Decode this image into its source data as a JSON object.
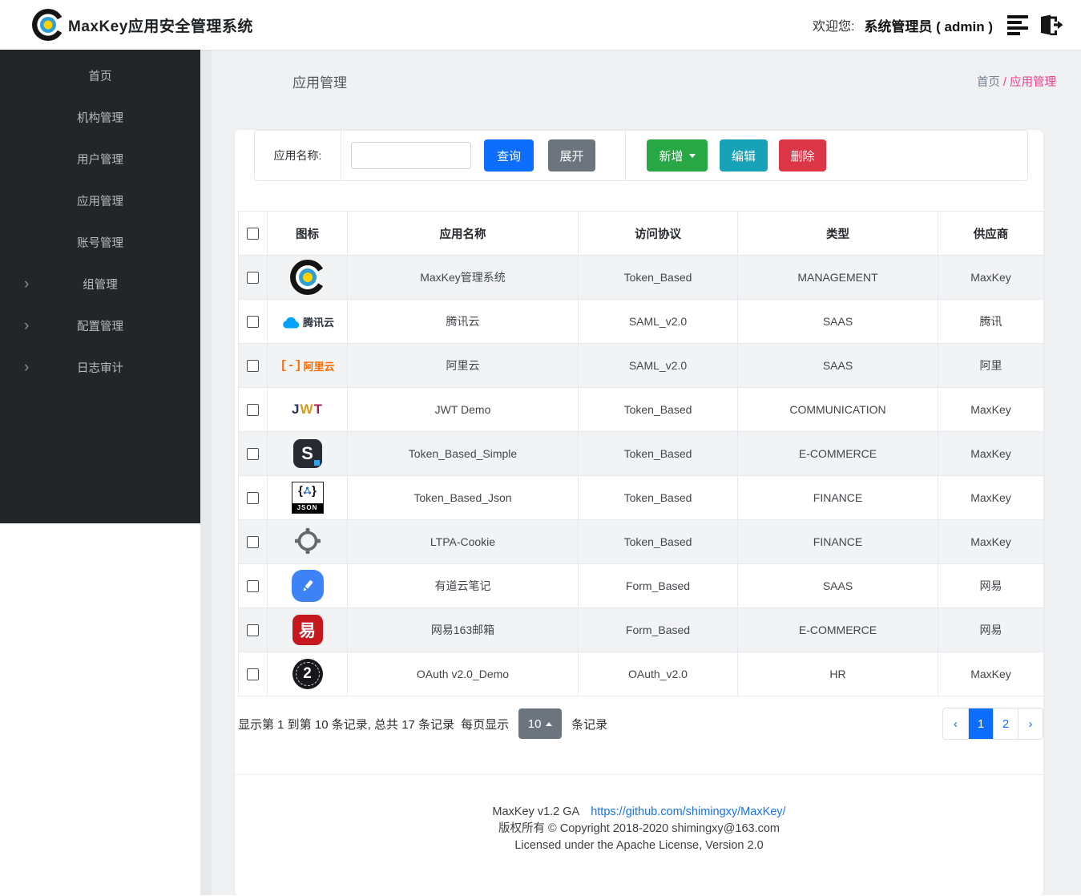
{
  "header": {
    "logo_title": "MaxKey应用安全管理系统",
    "welcome_prefix": "欢迎您:",
    "user": "系统管理员 ( admin )"
  },
  "sidebar": {
    "items": [
      {
        "label": "首页",
        "has_children": false
      },
      {
        "label": "机构管理",
        "has_children": false
      },
      {
        "label": "用户管理",
        "has_children": false
      },
      {
        "label": "应用管理",
        "has_children": false
      },
      {
        "label": "账号管理",
        "has_children": false
      },
      {
        "label": "组管理",
        "has_children": true
      },
      {
        "label": "配置管理",
        "has_children": true
      },
      {
        "label": "日志审计",
        "has_children": true
      }
    ]
  },
  "page": {
    "title": "应用管理",
    "breadcrumb": {
      "home": "首页",
      "separator": " / ",
      "current": "应用管理"
    }
  },
  "toolbar": {
    "search_label": "应用名称:",
    "search_value": "",
    "query_label": "查询",
    "expand_label": "展开",
    "add_label": "新增",
    "edit_label": "编辑",
    "delete_label": "删除"
  },
  "table": {
    "columns": [
      "图标",
      "应用名称",
      "访问协议",
      "类型",
      "供应商"
    ],
    "rows": [
      {
        "icon": "maxkey-logo",
        "name": "MaxKey管理系统",
        "protocol": "Token_Based",
        "type": "MANAGEMENT",
        "vendor": "MaxKey"
      },
      {
        "icon": "tencent-cloud",
        "name": "腾讯云",
        "protocol": "SAML_v2.0",
        "type": "SAAS",
        "vendor": "腾讯"
      },
      {
        "icon": "aliyun",
        "name": "阿里云",
        "protocol": "SAML_v2.0",
        "type": "SAAS",
        "vendor": "阿里"
      },
      {
        "icon": "jwt",
        "name": "JWT Demo",
        "protocol": "Token_Based",
        "type": "COMMUNICATION",
        "vendor": "MaxKey"
      },
      {
        "icon": "s-badge",
        "name": "Token_Based_Simple",
        "protocol": "Token_Based",
        "type": "E-COMMERCE",
        "vendor": "MaxKey"
      },
      {
        "icon": "json",
        "name": "Token_Based_Json",
        "protocol": "Token_Based",
        "type": "FINANCE",
        "vendor": "MaxKey"
      },
      {
        "icon": "ltpa-target",
        "name": "LTPA-Cookie",
        "protocol": "Token_Based",
        "type": "FINANCE",
        "vendor": "MaxKey"
      },
      {
        "icon": "youdao-note",
        "name": "有道云笔记",
        "protocol": "Form_Based",
        "type": "SAAS",
        "vendor": "网易"
      },
      {
        "icon": "netease-163",
        "name": "网易163邮箱",
        "protocol": "Form_Based",
        "type": "E-COMMERCE",
        "vendor": "网易"
      },
      {
        "icon": "oauth2",
        "name": "OAuth v2.0_Demo",
        "protocol": "OAuth_v2.0",
        "type": "HR",
        "vendor": "MaxKey"
      }
    ]
  },
  "icons": {
    "tencent_text": "腾讯云",
    "aliyun_bracket": "[-]",
    "aliyun_text": "阿里云",
    "jwt_letters": [
      "J",
      "W",
      "T"
    ],
    "s_letter": "S",
    "json_label": "JSON",
    "json_brace_open": "{",
    "json_brace_close": "}",
    "netease_glyph": "易",
    "oauth_number": "2"
  },
  "pagination": {
    "summary_left": "显示第 1 到第 10 条记录, 总共 17 条记录",
    "per_page_label": "每页显示",
    "page_size": "10",
    "suffix": "条记录",
    "prev": "‹",
    "pages": [
      "1",
      "2"
    ],
    "active_page": "1",
    "next": "›"
  },
  "footer": {
    "version": "MaxKey  v1.2 GA",
    "link": "https://github.com/shimingxy/MaxKey/",
    "copyright": "版权所有 © Copyright 2018-2020 shimingxy@163.com",
    "license": "Licensed under the Apache License, Version 2.0"
  },
  "colors": {
    "primary": "#0d6efd",
    "success": "#28a745",
    "info": "#17a2b8",
    "danger": "#dc3545",
    "secondary": "#6c757d",
    "breadcrumb_active": "#e83e8c",
    "sidebar_bg": "#222629"
  }
}
